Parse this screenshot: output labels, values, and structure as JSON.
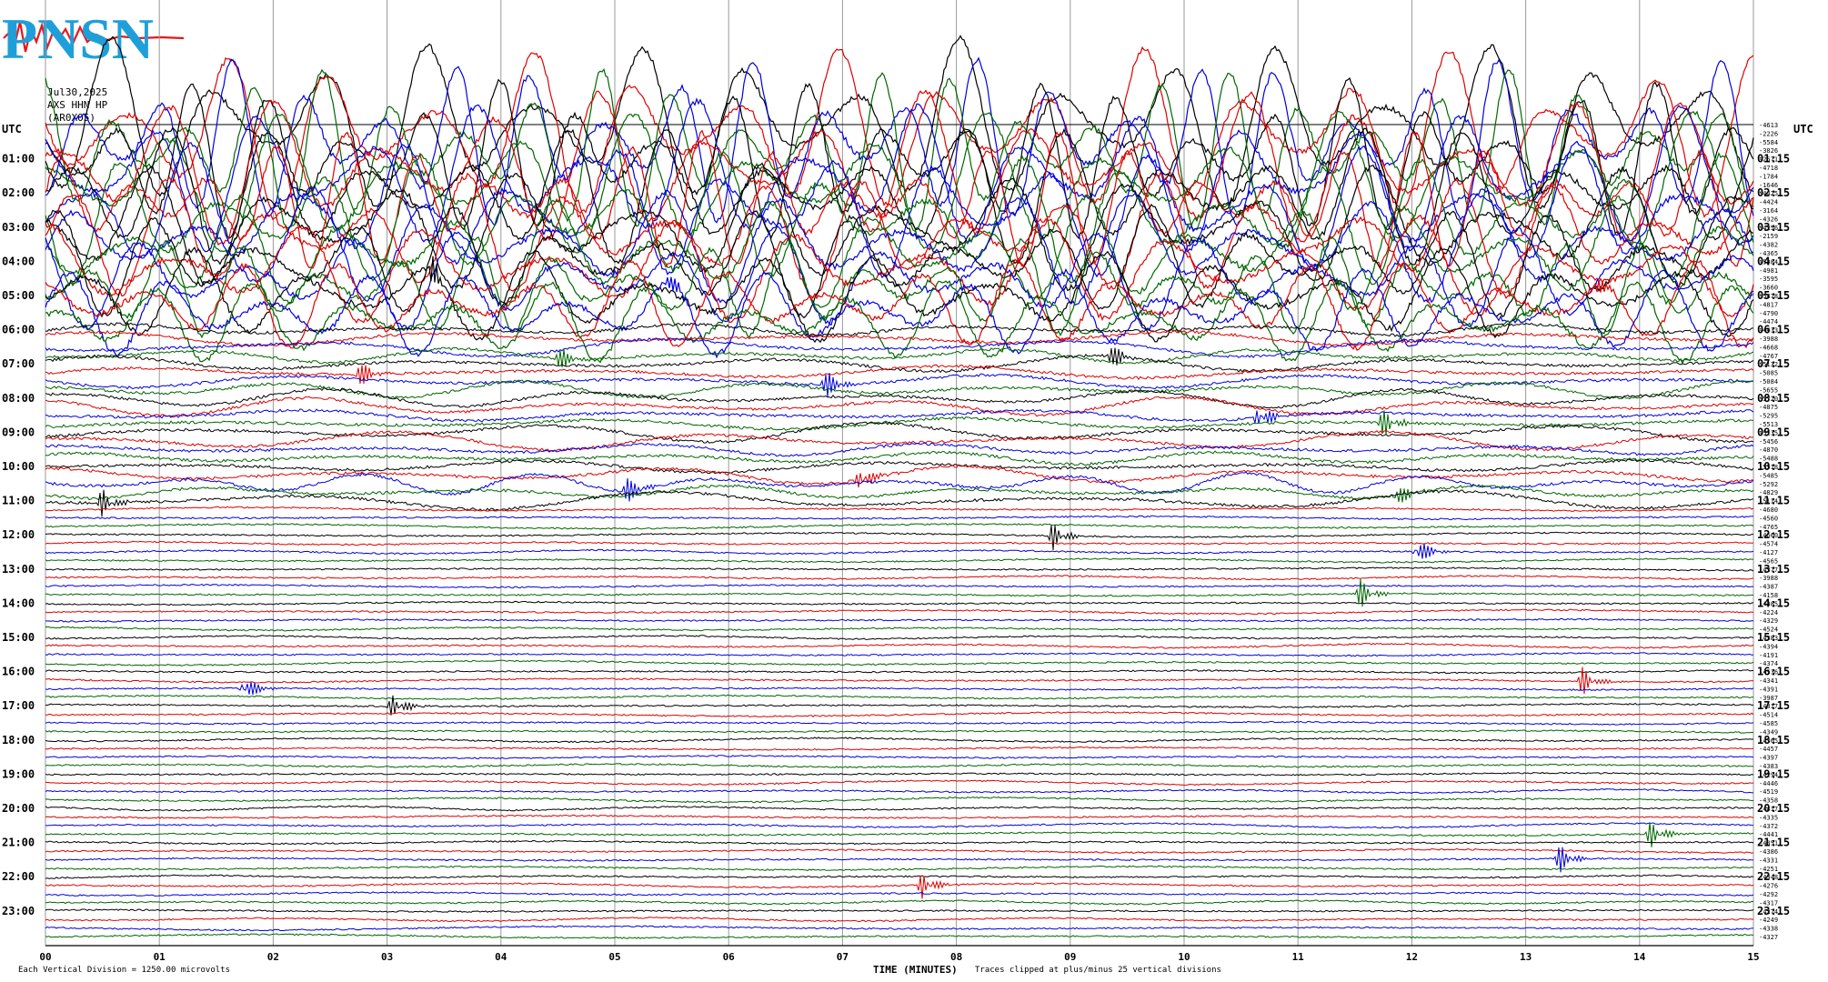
{
  "logo": {
    "text": "PNSN"
  },
  "header": {
    "date": "Jul30,2025",
    "channel": "AXS HHN HP",
    "station": "(AR0XO5)"
  },
  "left_timezone": "UTC",
  "right_timezone": "UTC",
  "footer": {
    "scale_note": "Each Vertical Division = 1250.00 microvolts",
    "clip_note": "Traces clipped at plus/minus 25 vertical divisions",
    "x_axis_title": "TIME (MINUTES)"
  },
  "colors": {
    "black": "#000000",
    "red": "#dd0000",
    "blue": "#0000dd",
    "green": "#006600",
    "grid": "#9a9a9a",
    "logo_red": "#e4191c",
    "logo_blue": "#1f9fd9"
  },
  "chart_data": {
    "type": "line",
    "title": "",
    "xlabel": "TIME (MINUTES)",
    "ylabel": "",
    "xlim": [
      0,
      15
    ],
    "x_ticks": [
      "00",
      "01",
      "02",
      "03",
      "04",
      "05",
      "06",
      "07",
      "08",
      "09",
      "10",
      "11",
      "12",
      "13",
      "14",
      "15"
    ],
    "trace_count": 96,
    "trace_minutes": 15,
    "color_cycle": [
      "black",
      "red",
      "blue",
      "green"
    ],
    "left_hour_labels": [
      "01:00",
      "02:00",
      "03:00",
      "04:00",
      "05:00",
      "06:00",
      "07:00",
      "08:00",
      "09:00",
      "10:00",
      "11:00",
      "12:00",
      "13:00",
      "14:00",
      "15:00",
      "16:00",
      "17:00",
      "18:00",
      "19:00",
      "20:00",
      "21:00",
      "22:00",
      "23:00"
    ],
    "right_hour_labels": [
      "01:15",
      "02:15",
      "03:15",
      "04:15",
      "05:15",
      "06:15",
      "07:15",
      "08:15",
      "09:15",
      "10:15",
      "11:15",
      "12:15",
      "13:15",
      "14:15",
      "15:15",
      "16:15",
      "17:15",
      "18:15",
      "19:15",
      "20:15",
      "21:15",
      "22:15",
      "23:15"
    ],
    "trace_offsets": [
      -4613,
      -2226,
      -5584,
      -3826,
      -2571,
      -4718,
      -1784,
      -1646,
      -4425,
      -4424,
      -3164,
      -4326,
      -4256,
      -2159,
      -4382,
      -4365,
      -5284,
      -4981,
      -3595,
      -3660,
      -5478,
      -4817,
      -4790,
      -4474,
      -4433,
      -3988,
      -4668,
      -4767,
      -5132,
      -5085,
      -5084,
      -5655,
      -5720,
      -4875,
      -5295,
      -5513,
      -5135,
      -5456,
      -4870,
      -5488,
      -5518,
      -5485,
      -5292,
      -4829,
      -5114,
      -4680,
      -4560,
      -4765,
      -4660,
      -4574,
      -4127,
      -4565,
      -4377,
      -3988,
      -4387,
      -4158,
      -4385,
      -4224,
      -4329,
      -4524,
      -4383,
      -4394,
      -4191,
      -4374,
      -4536,
      -4341,
      -4391,
      -3987,
      -4317,
      -4514,
      -4585,
      -4349,
      -4365,
      -4457,
      -4397,
      -4383,
      -4294,
      -4446,
      -4519,
      -4358,
      -4417,
      -4335,
      -4372,
      -4441,
      -4351,
      -4386,
      -4331,
      -4251,
      -4348,
      -4276,
      -4292,
      -4317,
      -4274,
      -4249,
      -4338,
      -4327
    ],
    "activity": [
      {
        "trace_range": [
          0,
          24
        ],
        "level": "high",
        "note": "large-amplitude oscillations, clipped"
      },
      {
        "trace_range": [
          24,
          45
        ],
        "level": "moderate"
      },
      {
        "trace_range": [
          45,
          96
        ],
        "level": "low"
      }
    ],
    "events": [
      {
        "trace": 20,
        "minute": 3.4
      },
      {
        "trace": 22,
        "minute": 5.45
      },
      {
        "trace": 21,
        "minute": 13.6
      },
      {
        "trace": 27,
        "minute": 4.5
      },
      {
        "trace": 28,
        "minute": 9.35
      },
      {
        "trace": 29,
        "minute": 2.75
      },
      {
        "trace": 30,
        "minute": 6.85
      },
      {
        "trace": 35,
        "minute": 11.75
      },
      {
        "trace": 34,
        "minute": 10.65
      },
      {
        "trace": 42,
        "minute": 5.1
      },
      {
        "trace": 41,
        "minute": 7.15
      },
      {
        "trace": 43,
        "minute": 11.85
      },
      {
        "trace": 44,
        "minute": 0.5
      },
      {
        "trace": 48,
        "minute": 8.85
      },
      {
        "trace": 50,
        "minute": 12.05
      },
      {
        "trace": 55,
        "minute": 11.55
      },
      {
        "trace": 65,
        "minute": 13.5
      },
      {
        "trace": 66,
        "minute": 1.75
      },
      {
        "trace": 68,
        "minute": 3.05
      },
      {
        "trace": 83,
        "minute": 14.1
      },
      {
        "trace": 86,
        "minute": 13.3
      },
      {
        "trace": 89,
        "minute": 7.7
      }
    ]
  }
}
